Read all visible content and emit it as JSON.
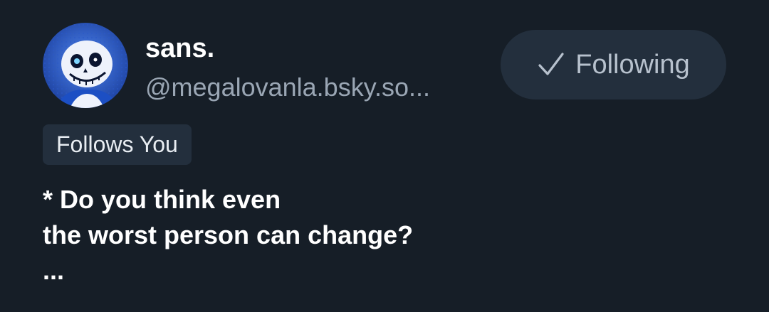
{
  "profile": {
    "display_name": "sans.",
    "handle": "@megalovanla.bsky.so...",
    "avatar_icon": "skeleton-avatar-icon",
    "follows_you_label": "Follows You"
  },
  "follow_button": {
    "label": "Following",
    "icon": "check-icon"
  },
  "bio": {
    "line1": "* Do you think even",
    "line2": "the worst person can change?",
    "line3": "..."
  },
  "colors": {
    "background": "#161e27",
    "button_bg": "#232f3d",
    "handle_text": "#9aa6b4",
    "button_text": "#b7c1cd",
    "avatar_accent": "#3b6fe0"
  }
}
